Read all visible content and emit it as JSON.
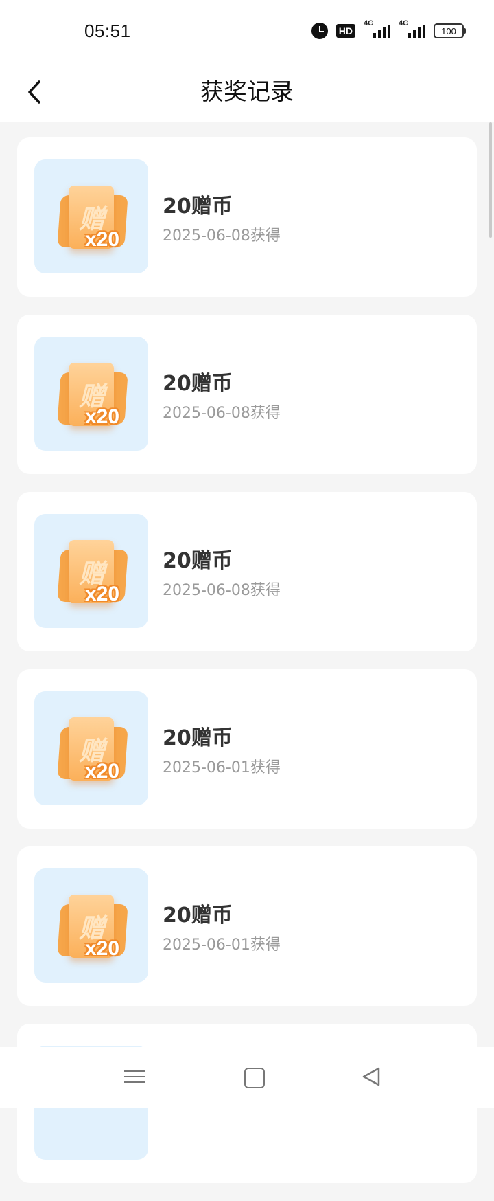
{
  "status_bar": {
    "time": "05:51",
    "hd_label": "HD",
    "network_label_1": "4G",
    "network_label_2": "4G",
    "battery": "100"
  },
  "header": {
    "title": "获奖记录",
    "back_icon": "chevron-left-icon"
  },
  "records": [
    {
      "name": "20赠币",
      "date": "2025-06-08获得",
      "coupon_char": "赠",
      "coupon_qty": "x20"
    },
    {
      "name": "20赠币",
      "date": "2025-06-08获得",
      "coupon_char": "赠",
      "coupon_qty": "x20"
    },
    {
      "name": "20赠币",
      "date": "2025-06-08获得",
      "coupon_char": "赠",
      "coupon_qty": "x20"
    },
    {
      "name": "20赠币",
      "date": "2025-06-01获得",
      "coupon_char": "赠",
      "coupon_qty": "x20"
    },
    {
      "name": "20赠币",
      "date": "2025-06-01获得",
      "coupon_char": "赠",
      "coupon_qty": "x20"
    },
    {
      "name": "",
      "date": "",
      "coupon_char": "",
      "coupon_qty": ""
    }
  ],
  "nav_bar": {
    "icons": [
      "menu-icon",
      "home-icon",
      "back-icon"
    ]
  }
}
